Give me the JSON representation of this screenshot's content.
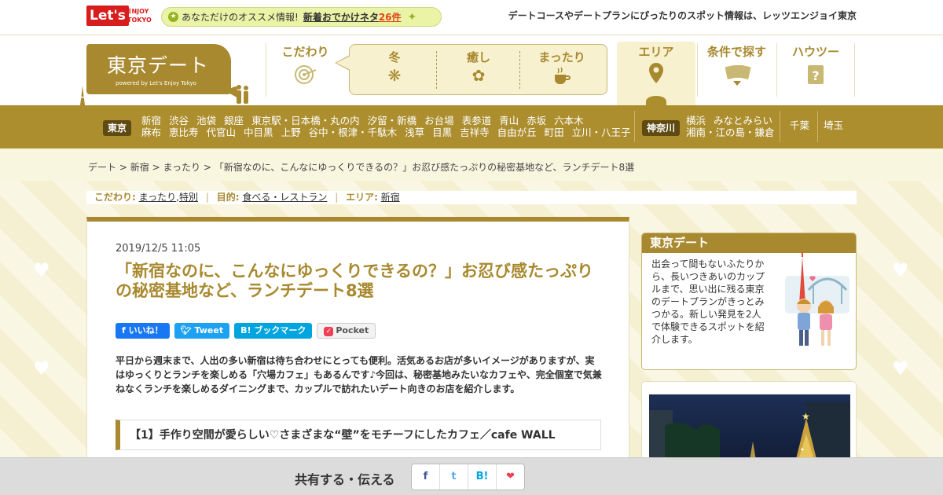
{
  "top": {
    "logo_main": "Let's",
    "logo_sub_top": "ENJOY",
    "logo_sub_bottom": "TOKYO",
    "reco_prefix": "あなただけのオススメ情報!",
    "reco_link": "新着おでかけネタ",
    "reco_count": "26件",
    "tagline": "デートコースやデートプランにぴったりのスポット情報は、レッツエンジョイ東京"
  },
  "brand": {
    "title": "東京デート",
    "sub": "powered by Let's Enjoy Tokyo"
  },
  "nav": {
    "kodawari": "こだわり",
    "sub_items": [
      {
        "label": "冬",
        "icon": "snowflake-icon"
      },
      {
        "label": "癒し",
        "icon": "flower-icon"
      },
      {
        "label": "まったり",
        "icon": "coffee-icon"
      }
    ],
    "area": "エリア",
    "joken": "条件で探す",
    "howto": "ハウツー"
  },
  "areas": {
    "tokyo_tag": "東京",
    "tokyo_row1": [
      "新宿",
      "渋谷",
      "池袋",
      "銀座",
      "東京駅・日本橋・丸の内",
      "汐留・新橋",
      "お台場",
      "表参道",
      "青山",
      "赤坂",
      "六本木"
    ],
    "tokyo_row2": [
      "麻布",
      "恵比寿",
      "代官山",
      "中目黒",
      "上野",
      "谷中・根津・千駄木",
      "浅草",
      "目黒",
      "吉祥寺",
      "自由が丘",
      "町田",
      "立川・八王子"
    ],
    "kanagawa_tag": "神奈川",
    "kanagawa_row1": [
      "横浜",
      "みなとみらい"
    ],
    "kanagawa_row2": [
      "湘南・江の島・鎌倉"
    ],
    "chiba": "千葉",
    "saitama": "埼玉"
  },
  "breadcrumb": {
    "items": [
      "デート",
      "新宿",
      "まったり"
    ],
    "separator": ">",
    "current": "「新宿なのに、こんなにゆっくりできるの？」お忍び感たっぷりの秘密基地など、ランチデート8選"
  },
  "filter": {
    "kodawari_key": "こだわり:",
    "kodawari_1": "まったり",
    "kodawari_2": "特別",
    "purpose_key": "目的:",
    "purpose": "食べる・レストラン",
    "area_key": "エリア:",
    "area": "新宿"
  },
  "article": {
    "date": "2019/12/5 11:05",
    "title": "「新宿なのに、こんなにゆっくりできるの？」お忍び感たっぷりの秘密基地など、ランチデート8選",
    "share_fb": "いいね！",
    "share_tw": "Tweet",
    "share_hb": "B! ブックマーク",
    "share_pocket": "Pocket",
    "lead": "平日から週末まで、人出の多い新宿は待ち合わせにとっても便利。活気あるお店が多いイメージがありますが、実はゆっくりとランチを楽しめる「穴場カフェ」もあるんです♪今回は、秘密基地みたいなカフェや、完全個室で気兼ねなくランチを楽しめるダイニングまで、カップルで訪れたいデート向きのお店を紹介します。",
    "section1": "【1】手作り空間が愛らしい♡さまざまな“壁”をモチーフにしたカフェ／cafe WALL"
  },
  "sidebar": {
    "title": "東京デート",
    "text": "出会って間もないふたりから、長いつきあいのカップルまで、思い出に残る東京のデートプランがきっとみつかる。新しい発見を2人で体験できるスポットを紹介します。"
  },
  "sharebar": {
    "label": "共有する・伝える",
    "f": "f",
    "t": "t",
    "b": "B!",
    "more": "❤"
  },
  "colors": {
    "gold": "#a8892f",
    "gold_dark": "#5e4a12",
    "cream": "#f8f1cf",
    "red": "#d81d1d"
  }
}
